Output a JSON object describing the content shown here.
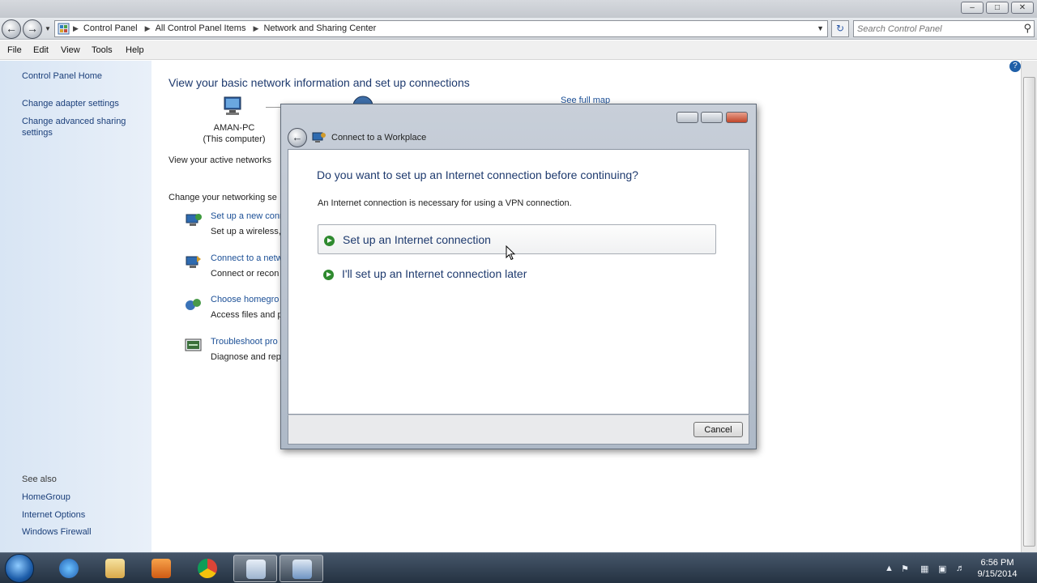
{
  "window": {
    "buttons": {
      "minimize": "–",
      "maximize": "□",
      "close": "✕"
    }
  },
  "nav": {
    "back_icon": "back-arrow-icon",
    "forward_icon": "forward-arrow-icon",
    "breadcrumb": [
      "Control Panel",
      "All Control Panel Items",
      "Network and Sharing Center"
    ],
    "search_placeholder": "Search Control Panel"
  },
  "menu": [
    "File",
    "Edit",
    "View",
    "Tools",
    "Help"
  ],
  "left_pane": {
    "links": [
      "Control Panel Home",
      "Change adapter settings",
      "Change advanced sharing settings"
    ],
    "see_also_heading": "See also",
    "see_also": [
      "HomeGroup",
      "Internet Options",
      "Windows Firewall"
    ]
  },
  "main": {
    "title": "View your basic network information and set up connections",
    "computer_name": "AMAN-PC",
    "computer_sub": "(This computer)",
    "see_full_map": "See full map",
    "active_networks_label": "View your active networks",
    "change_settings_label": "Change your networking se",
    "tasks": [
      {
        "link": "Set up a new conn",
        "desc": "Set up a wireless,"
      },
      {
        "link": "Connect to a netw",
        "desc": "Connect or recon"
      },
      {
        "link": "Choose homegro",
        "desc": "Access files and p"
      },
      {
        "link": "Troubleshoot pro",
        "desc": "Diagnose and rep"
      }
    ]
  },
  "dialog": {
    "title": "Connect to a Workplace",
    "question": "Do you want to set up an Internet connection before continuing?",
    "note": "An Internet connection is necessary for using a VPN connection.",
    "options": [
      "Set up an Internet connection",
      "I'll set up an Internet connection later"
    ],
    "cancel": "Cancel"
  },
  "taskbar": {
    "time": "6:56 PM",
    "date": "9/15/2014"
  },
  "colors": {
    "link_blue": "#1b4f96",
    "heading_blue": "#1e3a6e",
    "left_pane_bg": "#dce8f6",
    "taskbar": "#2f3e51"
  }
}
